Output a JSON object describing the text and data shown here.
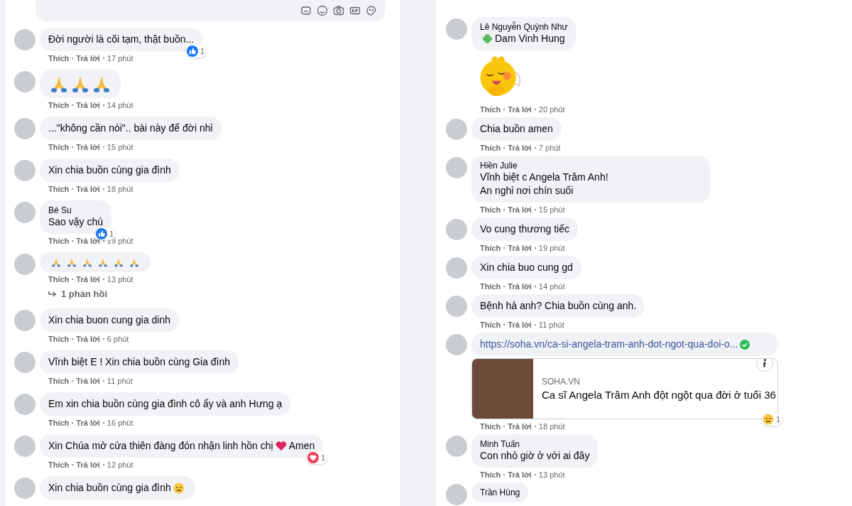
{
  "left_panel": {
    "comments": [
      {
        "parts": [
          {
            "kind": "text",
            "text": "Đời người là cõi tạm, thật buồn..."
          }
        ],
        "reaction": {
          "kind": "like",
          "count": "1"
        },
        "like": "Thích",
        "reply": "Trả lời",
        "time": "17 phút"
      },
      {
        "parts": [
          {
            "kind": "pray-large"
          },
          {
            "kind": "pray-large"
          },
          {
            "kind": "pray-large"
          }
        ],
        "like": "Thích",
        "reply": "Trả lời",
        "time": "14 phút"
      },
      {
        "parts": [
          {
            "kind": "text",
            "text": "...\"không cần nói\".. bài này để đời nhỉ"
          }
        ],
        "like": "Thích",
        "reply": "Trả lời",
        "time": "15 phút"
      },
      {
        "parts": [
          {
            "kind": "text",
            "text": "Xin chia buồn cùng gia đình"
          }
        ],
        "like": "Thích",
        "reply": "Trả lời",
        "time": "18 phút"
      },
      {
        "name": "Bé Su",
        "parts": [
          {
            "kind": "text",
            "text": "Sao vậy chú"
          }
        ],
        "reaction": {
          "kind": "like",
          "count": "1"
        },
        "like": "Thích",
        "reply": "Trả lời",
        "time": "19 phút"
      },
      {
        "parts": [
          {
            "kind": "pray"
          },
          {
            "kind": "pray"
          },
          {
            "kind": "pray"
          },
          {
            "kind": "pray"
          },
          {
            "kind": "pray"
          },
          {
            "kind": "pray"
          }
        ],
        "like": "Thích",
        "reply": "Trả lời",
        "time": "13 phút",
        "replies": "1 phản hồi"
      },
      {
        "parts": [
          {
            "kind": "text",
            "text": "Xin chia buon cung gia dinh"
          }
        ],
        "like": "Thích",
        "reply": "Trả lời",
        "time": "6 phút"
      },
      {
        "parts": [
          {
            "kind": "text",
            "text": "Vĩnh biệt E ! Xin chia buồn cùng Gia đình"
          }
        ],
        "like": "Thích",
        "reply": "Trả lời",
        "time": "11 phút"
      },
      {
        "parts": [
          {
            "kind": "text",
            "text": "Em xin chia buồn cùng gia đình cô ấy và anh Hưng ạ"
          }
        ],
        "like": "Thích",
        "reply": "Trả lời",
        "time": "16 phút"
      },
      {
        "parts": [
          {
            "kind": "text",
            "text": "Xin Chúa mở cửa thiên đàng đón nhận linh hồn chị"
          },
          {
            "kind": "heart"
          },
          {
            "kind": "text",
            "text": "Amen"
          }
        ],
        "reaction": {
          "kind": "love",
          "count": "1"
        },
        "like": "Thích",
        "reply": "Trả lời",
        "time": "12 phút"
      },
      {
        "parts": [
          {
            "kind": "text",
            "text": "Xin chia buồn cùng gia đình"
          },
          {
            "kind": "sad"
          }
        ]
      }
    ]
  },
  "right_panel": {
    "comments": [
      {
        "name": "Lê Nguyễn Quỳnh Như",
        "parts": [
          {
            "kind": "clover"
          },
          {
            "kind": "text",
            "text": "Dam Vinh Hung"
          }
        ],
        "attachment": {
          "kind": "sticker"
        },
        "like": "Thích",
        "reply": "Trả lời",
        "time": "20 phút"
      },
      {
        "parts": [
          {
            "kind": "text",
            "text": "Chia buồn amen"
          }
        ],
        "like": "Thích",
        "reply": "Trả lời",
        "time": "7 phút"
      },
      {
        "name": "Hiền Julie",
        "parts": [
          {
            "kind": "text",
            "text": "Vĩnh biệt c Angela Trâm Anh!"
          },
          {
            "kind": "break"
          },
          {
            "kind": "text",
            "text": "An nghỉ nơi chín suối"
          }
        ],
        "like": "Thích",
        "reply": "Trả lời",
        "time": "15 phút"
      },
      {
        "parts": [
          {
            "kind": "text",
            "text": "Vo cung thương tiếc"
          }
        ],
        "like": "Thích",
        "reply": "Trả lời",
        "time": "19 phút"
      },
      {
        "parts": [
          {
            "kind": "text",
            "text": "Xin chia buo cung gd"
          }
        ],
        "like": "Thích",
        "reply": "Trả lời",
        "time": "14 phút"
      },
      {
        "parts": [
          {
            "kind": "text",
            "text": "Bệnh hả anh? Chia buồn cùng anh."
          }
        ],
        "like": "Thích",
        "reply": "Trả lời",
        "time": "11 phút"
      },
      {
        "parts": [
          {
            "kind": "link",
            "text": "https://soha.vn/ca-si-angela-tram-anh-dot-ngot-qua-doi-o...",
            "verified": true
          }
        ],
        "attachment": {
          "kind": "link_preview",
          "source": "SOHA.VN",
          "title": "Ca sĩ Angela Trâm Anh đột ngột qua đời ở tuổi 36"
        },
        "reaction": {
          "kind": "sad",
          "count": "1"
        },
        "like": "Thích",
        "reply": "Trả lời",
        "time": "18 phút"
      },
      {
        "name": "Minh Tuấn",
        "parts": [
          {
            "kind": "text",
            "text": "Con nhỏ giờ ở với ai đây"
          }
        ],
        "like": "Thích",
        "reply": "Trả lời",
        "time": "13 phút"
      },
      {
        "name": "Trần Hùng"
      }
    ]
  }
}
